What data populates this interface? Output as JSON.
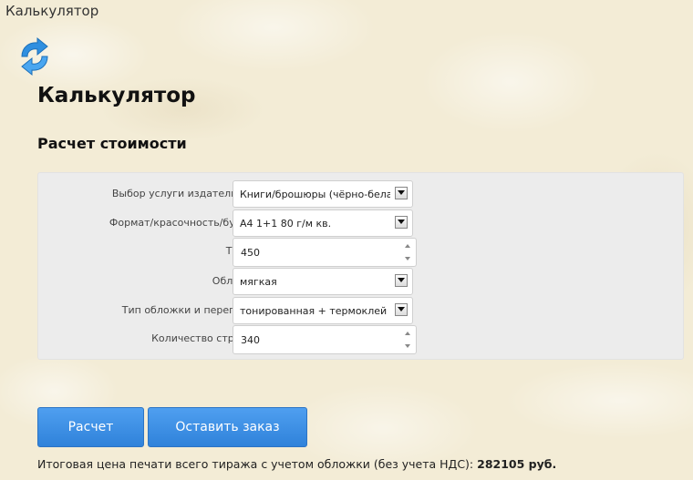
{
  "window": {
    "title": "Калькулятор"
  },
  "icons": {
    "app": "refresh-icon",
    "dropdown": "chevron-down-icon"
  },
  "page": {
    "title": "Калькулятор",
    "section_title": "Расчет стоимости"
  },
  "form": {
    "service": {
      "label": "Выбор услуги издательство:",
      "value": "Книги/брошюры (чёрно-белая"
    },
    "format": {
      "label": "Формат/красочность/бумага:",
      "value": "А4 1+1 80 г/м кв."
    },
    "quantity": {
      "label": "Тираж:",
      "value": "450"
    },
    "cover": {
      "label": "Обложка:",
      "value": "мягкая"
    },
    "binding": {
      "label": "Тип обложки и переплета:",
      "value": "тонированная + термоклей"
    },
    "pages": {
      "label": "Количество страниц:",
      "value": "340"
    }
  },
  "buttons": {
    "calculate": "Расчет",
    "order": "Оставить заказ"
  },
  "total": {
    "text": "Итоговая цена печати всего тиража с учетом обложки (без учета НДС): ",
    "amount": "282105 руб."
  },
  "colors": {
    "accent": "#3a8fe6",
    "panel": "#ececec",
    "background": "#f3ecd6"
  }
}
